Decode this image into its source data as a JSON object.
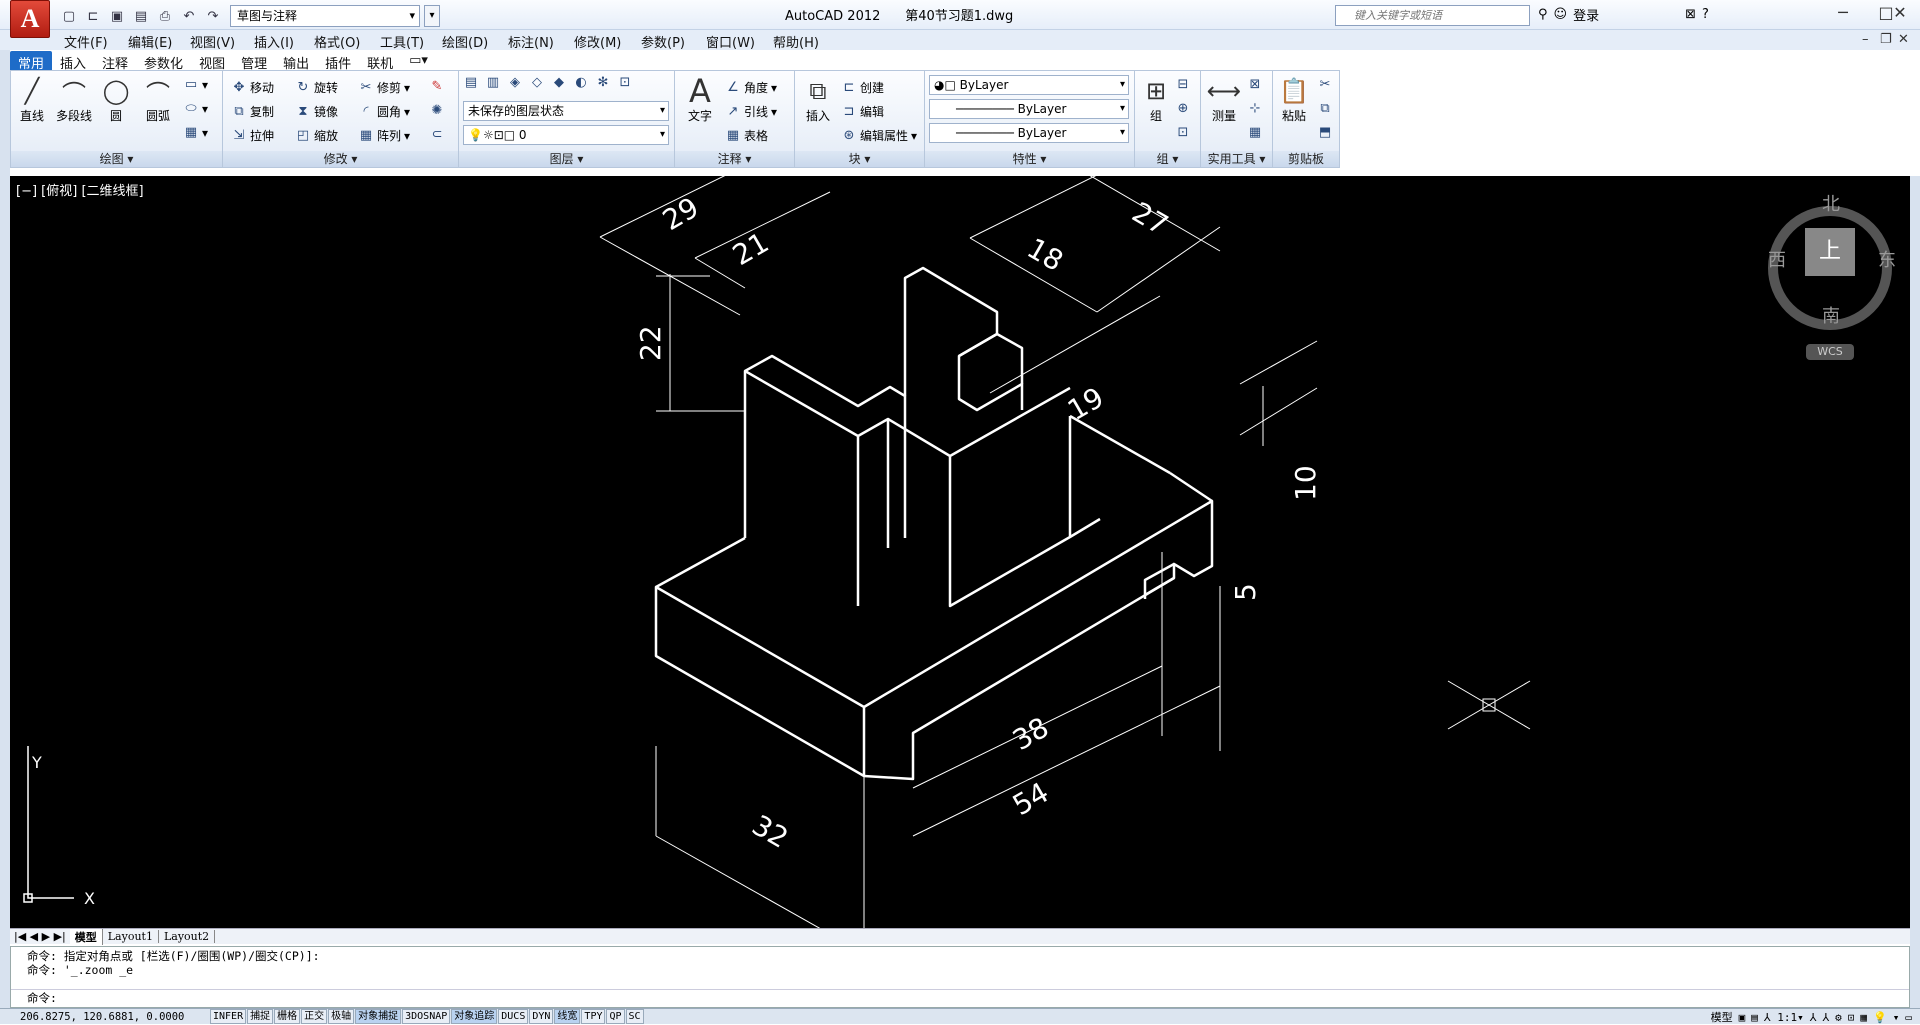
{
  "titlebar": {
    "app_letter": "A",
    "workspace": "草图与注释",
    "app_name": "AutoCAD 2012",
    "file_name": "第40节习题1.dwg",
    "search_placeholder": "键入关键字或短语",
    "login": "登录"
  },
  "menu": [
    "文件(F)",
    "编辑(E)",
    "视图(V)",
    "插入(I)",
    "格式(O)",
    "工具(T)",
    "绘图(D)",
    "标注(N)",
    "修改(M)",
    "参数(P)",
    "窗口(W)",
    "帮助(H)"
  ],
  "tabs": [
    "常用",
    "插入",
    "注释",
    "参数化",
    "视图",
    "管理",
    "输出",
    "插件",
    "联机"
  ],
  "ribbon": {
    "draw": {
      "label": "绘图",
      "line": "直线",
      "polyline": "多段线",
      "circle": "圆",
      "arc": "圆弧"
    },
    "modify": {
      "label": "修改",
      "move": "移动",
      "rotate": "旋转",
      "trim": "修剪",
      "copy": "复制",
      "mirror": "镜像",
      "fillet": "圆角",
      "stretch": "拉伸",
      "scale": "缩放",
      "array": "阵列"
    },
    "layers": {
      "label": "图层",
      "state": "未保存的图层状态",
      "current": "0"
    },
    "annotation": {
      "label": "注释",
      "text": "文字",
      "dim": "角度",
      "leader": "引线",
      "table": "表格"
    },
    "block": {
      "label": "块",
      "insert": "插入",
      "create": "创建",
      "edit": "编辑",
      "edit_attr": "编辑属性"
    },
    "properties": {
      "label": "特性",
      "color": "ByLayer",
      "linetype": "ByLayer",
      "lineweight": "ByLayer"
    },
    "groups": {
      "label": "组",
      "group": "组"
    },
    "utilities": {
      "label": "实用工具",
      "measure": "测量"
    },
    "clipboard": {
      "label": "剪贴板",
      "paste": "粘贴"
    }
  },
  "viewport": {
    "label": "[−] [俯视] [二维线框]",
    "viewcube": {
      "north": "北",
      "south": "南",
      "east": "东",
      "west": "西",
      "top": "上",
      "wcs": "WCS"
    },
    "ucs": {
      "x": "X",
      "y": "Y"
    },
    "dimensions": [
      "29",
      "21",
      "18",
      "27",
      "22",
      "19",
      "10",
      "5",
      "38",
      "54",
      "32"
    ]
  },
  "layout_tabs": [
    "模型",
    "Layout1",
    "Layout2"
  ],
  "command": {
    "line1": "命令: 指定对角点或 [栏选(F)/圈围(WP)/圈交(CP)]:",
    "line2": "命令: '_.zoom _e",
    "prompt": "命令:"
  },
  "status": {
    "coords": "206.8275, 120.6881, 0.0000",
    "toggles": [
      "INFER",
      "捕捉",
      "栅格",
      "正交",
      "极轴",
      "对象捕捉",
      "3DOSNAP",
      "对象追踪",
      "DUCS",
      "DYN",
      "线宽",
      "TPY",
      "QP",
      "SC"
    ],
    "toggles_on": [
      "对象捕捉",
      "对象追踪",
      "线宽"
    ],
    "model": "模型",
    "scale": "1:1"
  }
}
